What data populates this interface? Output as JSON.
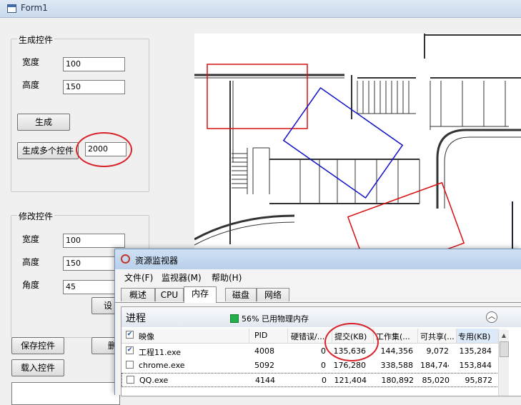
{
  "form": {
    "title": "Form1",
    "group_create": {
      "title": "生成控件",
      "width_label": "宽度",
      "width_value": "100",
      "height_label": "高度",
      "height_value": "150",
      "generate_button": "生成",
      "generate_multi_button": "生成多个控件",
      "count_value": "2000"
    },
    "group_modify": {
      "title": "修改控件",
      "width_label": "宽度",
      "width_value": "100",
      "height_label": "高度",
      "height_value": "150",
      "angle_label": "角度",
      "angle_value": "45",
      "set_button": "设"
    },
    "save_button": "保存控件",
    "delete_button": "删",
    "load_button": "载入控件"
  },
  "resource_monitor": {
    "title": "资源监视器",
    "menu": [
      "文件(F)",
      "监视器(M)",
      "帮助(H)"
    ],
    "tabs": [
      "概述",
      "CPU",
      "内存",
      "磁盘",
      "网络"
    ],
    "active_tab": "内存",
    "section_title": "进程",
    "memory_status": "56% 已用物理内存",
    "columns": [
      "映像",
      "PID",
      "硬错误/...",
      "提交(KB)",
      "工作集(...",
      "可共享(...",
      "专用(KB)"
    ],
    "rows": [
      {
        "name": "工程11.exe",
        "pid": "4008",
        "hard_faults": "0",
        "commit": "135,636",
        "working_set": "144,356",
        "shareable": "9,072",
        "private": "135,284",
        "checked": true
      },
      {
        "name": "chrome.exe",
        "pid": "5092",
        "hard_faults": "0",
        "commit": "176,280",
        "working_set": "338,588",
        "shareable": "184,744",
        "private": "153,844",
        "checked": false
      },
      {
        "name": "QQ.exe",
        "pid": "4144",
        "hard_faults": "0",
        "commit": "121,404",
        "working_set": "180,892",
        "shareable": "85,020",
        "private": "95,872",
        "checked": false
      }
    ]
  },
  "colors": {
    "annotation_red": "#d8232a",
    "blue_rect": "#1010c8",
    "red_rect": "#d81010",
    "memory_indicator": "#21b04a"
  }
}
